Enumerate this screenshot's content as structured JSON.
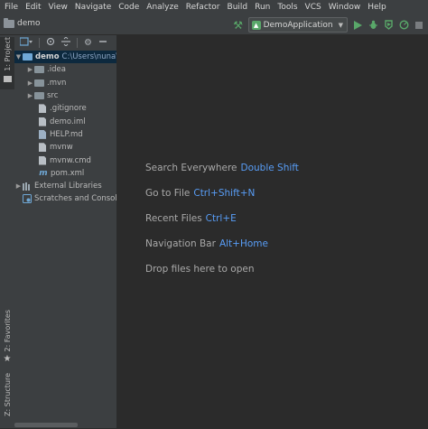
{
  "menu": [
    "File",
    "Edit",
    "View",
    "Navigate",
    "Code",
    "Analyze",
    "Refactor",
    "Build",
    "Run",
    "Tools",
    "VCS",
    "Window",
    "Help"
  ],
  "toolbar": {
    "breadcrumb": "demo",
    "run_config": "DemoApplication"
  },
  "side_tabs": {
    "project": "1: Project",
    "favorites": "2: Favorites",
    "structure": "Z: Structure"
  },
  "tree": [
    {
      "name": "demo",
      "path": "C:\\Users\\nuna\\"
    },
    {
      "name": ".idea"
    },
    {
      "name": ".mvn"
    },
    {
      "name": "src"
    },
    {
      "name": ".gitignore"
    },
    {
      "name": "demo.iml"
    },
    {
      "name": "HELP.md"
    },
    {
      "name": "mvnw"
    },
    {
      "name": "mvnw.cmd"
    },
    {
      "name": "pom.xml"
    },
    {
      "name": "External Libraries"
    },
    {
      "name": "Scratches and Consoles"
    }
  ],
  "hints": [
    {
      "label": "Search Everywhere",
      "shortcut": "Double Shift"
    },
    {
      "label": "Go to File",
      "shortcut": "Ctrl+Shift+N"
    },
    {
      "label": "Recent Files",
      "shortcut": "Ctrl+E"
    },
    {
      "label": "Navigation Bar",
      "shortcut": "Alt+Home"
    },
    {
      "label": "Drop files here to open",
      "shortcut": ""
    }
  ],
  "colors": {
    "accent": "#589df6",
    "panel": "#3c3f41",
    "editor": "#2b2b2b",
    "run": "#59a869"
  }
}
